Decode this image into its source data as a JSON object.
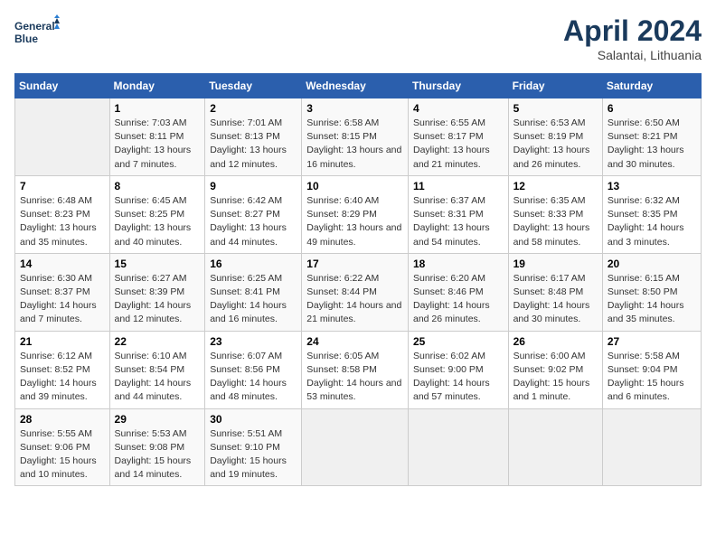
{
  "header": {
    "logo_line1": "General",
    "logo_line2": "Blue",
    "month": "April 2024",
    "location": "Salantai, Lithuania"
  },
  "weekdays": [
    "Sunday",
    "Monday",
    "Tuesday",
    "Wednesday",
    "Thursday",
    "Friday",
    "Saturday"
  ],
  "weeks": [
    [
      {
        "num": "",
        "empty": true
      },
      {
        "num": "1",
        "sunrise": "7:03 AM",
        "sunset": "8:11 PM",
        "daylight": "13 hours and 7 minutes."
      },
      {
        "num": "2",
        "sunrise": "7:01 AM",
        "sunset": "8:13 PM",
        "daylight": "13 hours and 12 minutes."
      },
      {
        "num": "3",
        "sunrise": "6:58 AM",
        "sunset": "8:15 PM",
        "daylight": "13 hours and 16 minutes."
      },
      {
        "num": "4",
        "sunrise": "6:55 AM",
        "sunset": "8:17 PM",
        "daylight": "13 hours and 21 minutes."
      },
      {
        "num": "5",
        "sunrise": "6:53 AM",
        "sunset": "8:19 PM",
        "daylight": "13 hours and 26 minutes."
      },
      {
        "num": "6",
        "sunrise": "6:50 AM",
        "sunset": "8:21 PM",
        "daylight": "13 hours and 30 minutes."
      }
    ],
    [
      {
        "num": "7",
        "sunrise": "6:48 AM",
        "sunset": "8:23 PM",
        "daylight": "13 hours and 35 minutes."
      },
      {
        "num": "8",
        "sunrise": "6:45 AM",
        "sunset": "8:25 PM",
        "daylight": "13 hours and 40 minutes."
      },
      {
        "num": "9",
        "sunrise": "6:42 AM",
        "sunset": "8:27 PM",
        "daylight": "13 hours and 44 minutes."
      },
      {
        "num": "10",
        "sunrise": "6:40 AM",
        "sunset": "8:29 PM",
        "daylight": "13 hours and 49 minutes."
      },
      {
        "num": "11",
        "sunrise": "6:37 AM",
        "sunset": "8:31 PM",
        "daylight": "13 hours and 54 minutes."
      },
      {
        "num": "12",
        "sunrise": "6:35 AM",
        "sunset": "8:33 PM",
        "daylight": "13 hours and 58 minutes."
      },
      {
        "num": "13",
        "sunrise": "6:32 AM",
        "sunset": "8:35 PM",
        "daylight": "14 hours and 3 minutes."
      }
    ],
    [
      {
        "num": "14",
        "sunrise": "6:30 AM",
        "sunset": "8:37 PM",
        "daylight": "14 hours and 7 minutes."
      },
      {
        "num": "15",
        "sunrise": "6:27 AM",
        "sunset": "8:39 PM",
        "daylight": "14 hours and 12 minutes."
      },
      {
        "num": "16",
        "sunrise": "6:25 AM",
        "sunset": "8:41 PM",
        "daylight": "14 hours and 16 minutes."
      },
      {
        "num": "17",
        "sunrise": "6:22 AM",
        "sunset": "8:44 PM",
        "daylight": "14 hours and 21 minutes."
      },
      {
        "num": "18",
        "sunrise": "6:20 AM",
        "sunset": "8:46 PM",
        "daylight": "14 hours and 26 minutes."
      },
      {
        "num": "19",
        "sunrise": "6:17 AM",
        "sunset": "8:48 PM",
        "daylight": "14 hours and 30 minutes."
      },
      {
        "num": "20",
        "sunrise": "6:15 AM",
        "sunset": "8:50 PM",
        "daylight": "14 hours and 35 minutes."
      }
    ],
    [
      {
        "num": "21",
        "sunrise": "6:12 AM",
        "sunset": "8:52 PM",
        "daylight": "14 hours and 39 minutes."
      },
      {
        "num": "22",
        "sunrise": "6:10 AM",
        "sunset": "8:54 PM",
        "daylight": "14 hours and 44 minutes."
      },
      {
        "num": "23",
        "sunrise": "6:07 AM",
        "sunset": "8:56 PM",
        "daylight": "14 hours and 48 minutes."
      },
      {
        "num": "24",
        "sunrise": "6:05 AM",
        "sunset": "8:58 PM",
        "daylight": "14 hours and 53 minutes."
      },
      {
        "num": "25",
        "sunrise": "6:02 AM",
        "sunset": "9:00 PM",
        "daylight": "14 hours and 57 minutes."
      },
      {
        "num": "26",
        "sunrise": "6:00 AM",
        "sunset": "9:02 PM",
        "daylight": "15 hours and 1 minute."
      },
      {
        "num": "27",
        "sunrise": "5:58 AM",
        "sunset": "9:04 PM",
        "daylight": "15 hours and 6 minutes."
      }
    ],
    [
      {
        "num": "28",
        "sunrise": "5:55 AM",
        "sunset": "9:06 PM",
        "daylight": "15 hours and 10 minutes."
      },
      {
        "num": "29",
        "sunrise": "5:53 AM",
        "sunset": "9:08 PM",
        "daylight": "15 hours and 14 minutes."
      },
      {
        "num": "30",
        "sunrise": "5:51 AM",
        "sunset": "9:10 PM",
        "daylight": "15 hours and 19 minutes."
      },
      {
        "num": "",
        "empty": true
      },
      {
        "num": "",
        "empty": true
      },
      {
        "num": "",
        "empty": true
      },
      {
        "num": "",
        "empty": true
      }
    ]
  ],
  "labels": {
    "sunrise": "Sunrise:",
    "sunset": "Sunset:",
    "daylight": "Daylight:"
  }
}
